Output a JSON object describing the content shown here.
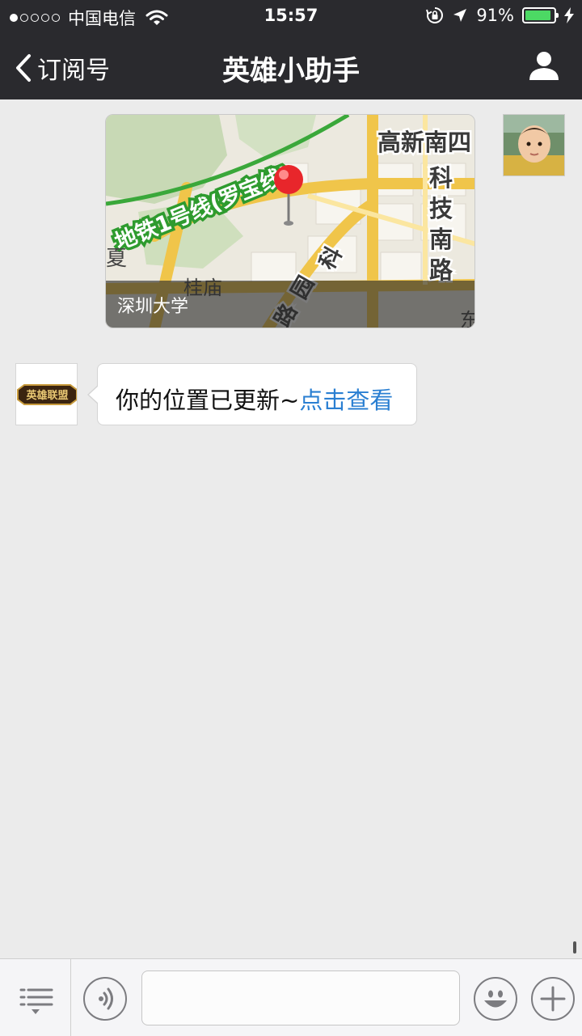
{
  "status_bar": {
    "carrier": "中国电信",
    "time": "15:57",
    "battery_percent": "91%",
    "battery_level": 0.91,
    "signal_dots_filled": 1,
    "signal_dots_total": 5,
    "icons": [
      "wifi-icon",
      "rotation-lock-icon",
      "location-arrow-icon",
      "battery-icon",
      "charging-icon"
    ]
  },
  "nav": {
    "back_label": "订阅号",
    "title": "英雄小助手",
    "profile_icon": "person-icon"
  },
  "messages": [
    {
      "type": "location",
      "sender": "self",
      "map_place": "深圳大学",
      "map_labels": [
        "地铁1号线(罗宝线)",
        "高新南四",
        "科技南路",
        "科园路",
        "桂庙",
        "夏",
        "东"
      ]
    },
    {
      "type": "text",
      "sender": "official-account",
      "avatar_logo": "英雄联盟",
      "text": "你的位置已更新~",
      "link_text": "点击查看",
      "link_color": "#2a7fd2"
    }
  ],
  "toolbar": {
    "input_value": "",
    "icons": [
      "menu-list-icon",
      "voice-icon",
      "emoji-icon",
      "plus-icon"
    ]
  },
  "colors": {
    "bar_background": "#2a2a2e",
    "chat_background": "#ebebeb",
    "battery_fill": "#4cd964",
    "pin": "#e8262b"
  }
}
